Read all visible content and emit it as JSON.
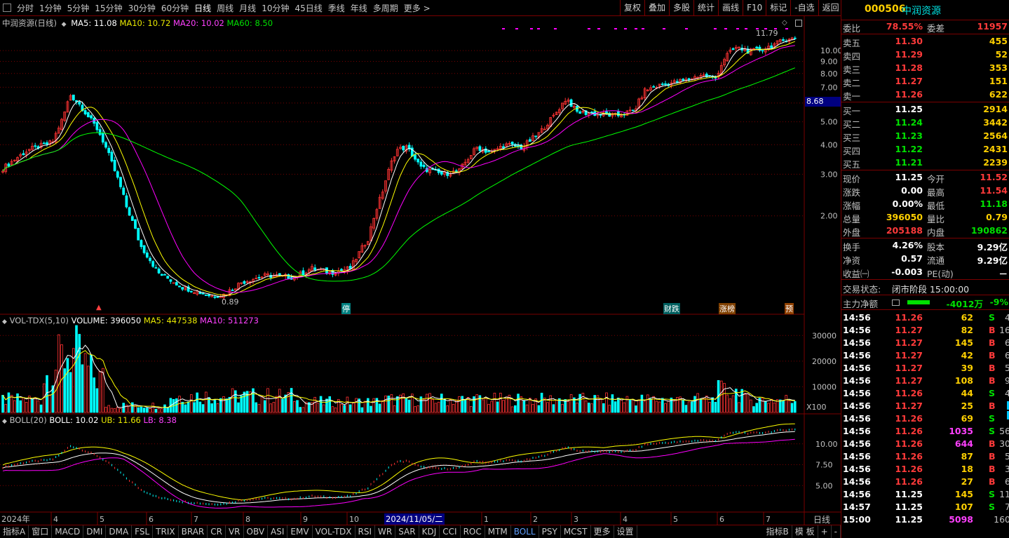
{
  "toolbar": {
    "items": [
      "分时",
      "1分钟",
      "5分钟",
      "15分钟",
      "30分钟",
      "60分钟",
      "日线",
      "周线",
      "月线",
      "10分钟",
      "45日线",
      "季线",
      "年线",
      "多周期",
      "更多 >"
    ],
    "active": "日线",
    "right": [
      "复权",
      "叠加",
      "多股",
      "统计",
      "画线",
      "F10",
      "标记",
      "-自选",
      "返回"
    ]
  },
  "stock": {
    "code": "000506",
    "name": "中润资源"
  },
  "main_pane": {
    "title": "中润资源(日线)",
    "ma5": "MA5: 11.08",
    "ma10": "MA10: 10.72",
    "ma20": "MA20: 10.02",
    "ma60": "MA60: 8.50",
    "high_label": "11.79",
    "low_label": "0.89",
    "price_tag": "8.68",
    "y_ticks": [
      "10.00",
      "9.00",
      "8.00",
      "7.00",
      "6.00",
      "5.00",
      "4.00",
      "3.00",
      "2.00"
    ],
    "badges": [
      "停",
      "财跌",
      "涨榜",
      "预"
    ]
  },
  "vol_pane": {
    "title": "VOL-TDX(5,10)",
    "volume": "VOLUME: 396050",
    "ma5": "MA5: 447538",
    "ma10": "MA10: 511273",
    "y_ticks": [
      "30000",
      "20000",
      "10000"
    ],
    "unit": "X100"
  },
  "boll_pane": {
    "title": "BOLL(20)",
    "boll": "BOLL: 10.02",
    "ub": "UB: 11.66",
    "lb": "LB: 8.38",
    "y_ticks": [
      "10.00",
      "7.50",
      "5.00"
    ]
  },
  "x_axis": {
    "year": "2024年",
    "months": [
      "4",
      "5",
      "6",
      "7",
      "8",
      "9",
      "10",
      "12",
      "1",
      "2",
      "3",
      "4",
      "5",
      "6",
      "7"
    ],
    "cursor_date": "2024/11/05/二",
    "period": "日线"
  },
  "colors": {
    "up": "#ff3232",
    "down": "#00ffff",
    "ma5": "#ffffff",
    "ma10": "#ffff00",
    "ma20": "#ff00ff",
    "ma60": "#00ff00",
    "grid": "#7a0000"
  },
  "quote": {
    "weibi_label": "委比",
    "weibi": "78.55%",
    "weicha_label": "委差",
    "weicha": "11957",
    "asks": [
      {
        "label": "卖五",
        "price": "11.30",
        "vol": "455"
      },
      {
        "label": "卖四",
        "price": "11.29",
        "vol": "52"
      },
      {
        "label": "卖三",
        "price": "11.28",
        "vol": "353"
      },
      {
        "label": "卖二",
        "price": "11.27",
        "vol": "151"
      },
      {
        "label": "卖一",
        "price": "11.26",
        "vol": "622"
      }
    ],
    "bids": [
      {
        "label": "买一",
        "price": "11.25",
        "vol": "2914"
      },
      {
        "label": "买二",
        "price": "11.24",
        "vol": "3442"
      },
      {
        "label": "买三",
        "price": "11.23",
        "vol": "2564"
      },
      {
        "label": "买四",
        "price": "11.22",
        "vol": "2431"
      },
      {
        "label": "买五",
        "price": "11.21",
        "vol": "2239"
      }
    ],
    "stats": [
      {
        "l1": "现价",
        "v1": "11.25",
        "l2": "今开",
        "v2": "11.52"
      },
      {
        "l1": "涨跌",
        "v1": "0.00",
        "l2": "最高",
        "v2": "11.54"
      },
      {
        "l1": "涨幅",
        "v1": "0.00%",
        "l2": "最低",
        "v2": "11.18"
      },
      {
        "l1": "总量",
        "v1": "396050",
        "l2": "量比",
        "v2": "0.79"
      },
      {
        "l1": "外盘",
        "v1": "205188",
        "l2": "内盘",
        "v2": "190862"
      }
    ],
    "stats2": [
      {
        "l1": "换手",
        "v1": "4.26%",
        "l2": "股本",
        "v2": "9.29亿"
      },
      {
        "l1": "净资",
        "v1": "0.57",
        "l2": "流通",
        "v2": "9.29亿"
      },
      {
        "l1": "收益㈠",
        "v1": "-0.003",
        "l2": "PE(动)",
        "v2": "－"
      }
    ],
    "status_label": "交易状态:",
    "status": "闭市阶段 15:00:00",
    "main_flow_label": "主力净额",
    "main_flow": "-4012万",
    "main_flow_pct": "-9%"
  },
  "trades": [
    {
      "t": "14:56",
      "p": "11.26",
      "v": "62",
      "s": "S",
      "n": "4"
    },
    {
      "t": "14:56",
      "p": "11.27",
      "v": "82",
      "s": "B",
      "n": "16"
    },
    {
      "t": "14:56",
      "p": "11.27",
      "v": "145",
      "s": "B",
      "n": "6"
    },
    {
      "t": "14:56",
      "p": "11.27",
      "v": "42",
      "s": "B",
      "n": "6"
    },
    {
      "t": "14:56",
      "p": "11.27",
      "v": "39",
      "s": "B",
      "n": "5"
    },
    {
      "t": "14:56",
      "p": "11.27",
      "v": "108",
      "s": "B",
      "n": "9"
    },
    {
      "t": "14:56",
      "p": "11.26",
      "v": "44",
      "s": "S",
      "n": "4"
    },
    {
      "t": "14:56",
      "p": "11.27",
      "v": "25",
      "s": "B",
      "n": ""
    },
    {
      "t": "14:56",
      "p": "11.26",
      "v": "69",
      "s": "S",
      "n": ""
    },
    {
      "t": "14:56",
      "p": "11.26",
      "v": "1035",
      "s": "S",
      "n": "56"
    },
    {
      "t": "14:56",
      "p": "11.26",
      "v": "644",
      "s": "B",
      "n": "30"
    },
    {
      "t": "14:56",
      "p": "11.26",
      "v": "87",
      "s": "B",
      "n": "5"
    },
    {
      "t": "14:56",
      "p": "11.26",
      "v": "18",
      "s": "B",
      "n": "3"
    },
    {
      "t": "14:56",
      "p": "11.26",
      "v": "27",
      "s": "B",
      "n": "6"
    },
    {
      "t": "14:56",
      "p": "11.25",
      "v": "145",
      "s": "S",
      "n": "11"
    },
    {
      "t": "14:57",
      "p": "11.25",
      "v": "107",
      "s": "S",
      "n": "7"
    },
    {
      "t": "15:00",
      "p": "11.25",
      "v": "5098",
      "s": "",
      "n": "160"
    }
  ],
  "bottom": {
    "items": [
      "指标A",
      "窗口",
      "MACD",
      "DMI",
      "DMA",
      "FSL",
      "TRIX",
      "BRAR",
      "CR",
      "VR",
      "OBV",
      "ASI",
      "EMV",
      "VOL-TDX",
      "RSI",
      "WR",
      "SAR",
      "KDJ",
      "CCI",
      "ROC",
      "MTM",
      "BOLL",
      "PSY",
      "MCST",
      "更多",
      "设置"
    ],
    "active": "BOLL",
    "right": [
      "指标B",
      "模 板",
      "+",
      "-"
    ]
  }
}
